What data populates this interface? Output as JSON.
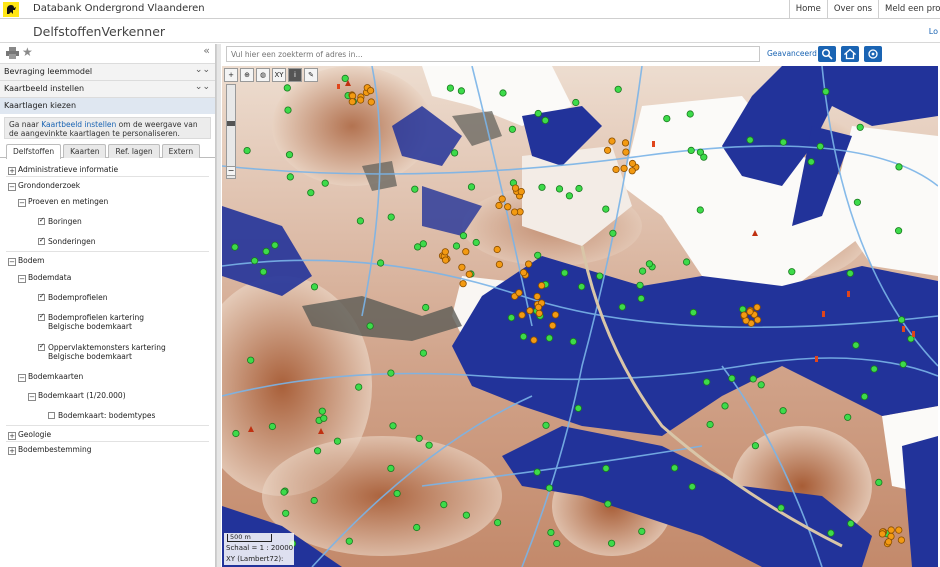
{
  "header": {
    "brand": "Databank Ondergrond Vlaanderen",
    "nav": [
      "Home",
      "Over ons",
      "Meld een proble"
    ],
    "app_title": "DelfstoffenVerkenner",
    "login_partial": "Lo"
  },
  "panel": {
    "sections": [
      {
        "label": "Bevraging leemmodel"
      },
      {
        "label": "Kaartbeeld instellen"
      },
      {
        "label": "Kaartlagen kiezen"
      }
    ],
    "info": {
      "before": "Ga naar ",
      "link": "Kaartbeeld instellen",
      "after": " om de weergave van de aangevinkte kaartlagen te personaliseren."
    },
    "tabs": [
      "Delfstoffen",
      "Kaarten",
      "Ref. lagen",
      "Extern"
    ],
    "tree": {
      "administratieve": "Administratieve informatie",
      "grondonderzoek": "Grondonderzoek",
      "proeven": "Proeven en metingen",
      "boringen": "Boringen",
      "sonderingen": "Sonderingen",
      "bodem": "Bodem",
      "bodemdata": "Bodemdata",
      "bodemprofielen": "Bodemprofielen",
      "bodemprofielen_kartering": "Bodemprofielen kartering Belgische bodemkaart",
      "oppervlaktemonsters": "Oppervlaktemonsters kartering Belgische bodemkaart",
      "bodemkaarten": "Bodemkaarten",
      "bodemkaart_20000": "Bodemkaart (1/20.000)",
      "bodemtypes": "Bodemkaart: bodemtypes",
      "geologie": "Geologie",
      "bodembestemming": "Bodembestemming"
    }
  },
  "search": {
    "placeholder": "Vul hier een zoekterm of adres in...",
    "advanced": "Geavanceerd"
  },
  "map": {
    "tools": [
      "XY"
    ],
    "scale_bar": "500 m",
    "scale": "Schaal = 1 : 20000",
    "coords": "XY (Lambert72):",
    "colors": {
      "water": "#22339a",
      "brown": "#a0522d",
      "green_point": "#3ddb4a",
      "orange_point": "#f39a12",
      "road": "#7ab4e8"
    }
  }
}
